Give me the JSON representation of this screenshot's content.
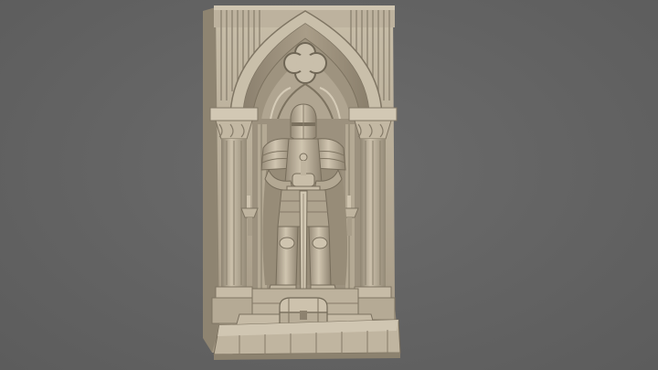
{
  "viewer": {
    "background_color": "#646464",
    "model_color": "#b7ab97",
    "shadow_color": "#6e6658",
    "highlight_color": "#d6ccba"
  },
  "scene": {
    "subject_icons": [
      "knight-statue-icon",
      "gothic-arch-icon",
      "treasure-chest-icon",
      "candle-icon"
    ]
  }
}
